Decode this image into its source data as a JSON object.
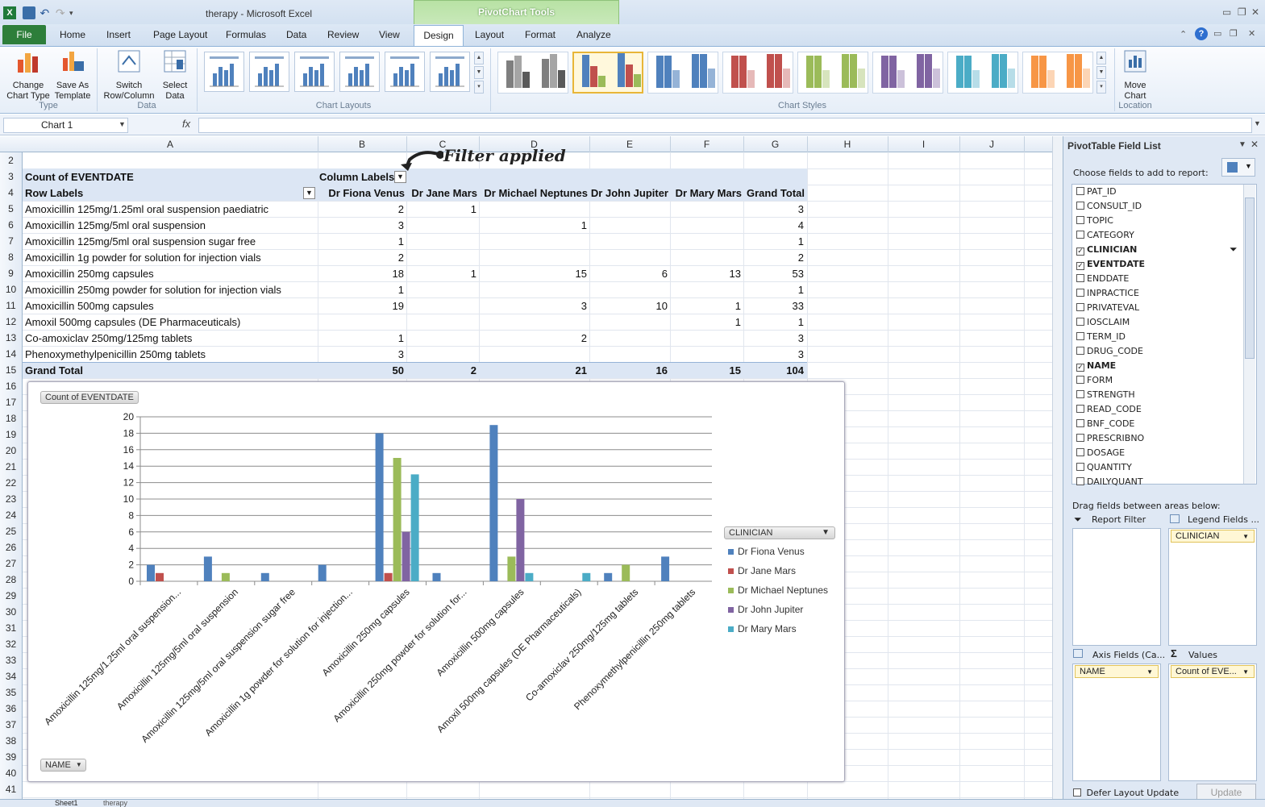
{
  "app": {
    "file_name": "therapy",
    "separator": " - ",
    "app_name": "Microsoft Excel",
    "context_group": "PivotChart Tools"
  },
  "tabs": {
    "file": "File",
    "home": "Home",
    "insert": "Insert",
    "page_layout": "Page Layout",
    "formulas": "Formulas",
    "data": "Data",
    "review": "Review",
    "view": "View",
    "design": "Design",
    "layout": "Layout",
    "format": "Format",
    "analyze": "Analyze"
  },
  "ribbon": {
    "change_chart_type": [
      "Change",
      "Chart Type"
    ],
    "save_as_template": [
      "Save As",
      "Template"
    ],
    "group_type": "Type",
    "switch_row_column": [
      "Switch",
      "Row/Column"
    ],
    "select_data": [
      "Select",
      "Data"
    ],
    "group_data": "Data",
    "group_layouts": "Chart Layouts",
    "group_styles": "Chart Styles",
    "move_chart": [
      "Move",
      "Chart"
    ],
    "group_location": "Location",
    "style_colors": [
      [
        "#7f7f7f",
        "#a5a5a5",
        "#595959"
      ],
      [
        "#4f81bd",
        "#c0504d",
        "#9bbb59"
      ],
      [
        "#4f81bd",
        "#4f81bd",
        "#95b3d7"
      ],
      [
        "#c0504d",
        "#c0504d",
        "#e6b9b8"
      ],
      [
        "#9bbb59",
        "#9bbb59",
        "#d7e4bd"
      ],
      [
        "#8064a2",
        "#8064a2",
        "#ccc1da"
      ],
      [
        "#4bacc6",
        "#4bacc6",
        "#b7dde8"
      ],
      [
        "#f79646",
        "#f79646",
        "#fcd5b5"
      ]
    ]
  },
  "formula_bar": {
    "name_box": "Chart 1",
    "fx": "fx",
    "formula": ""
  },
  "columns": [
    "A",
    "B",
    "C",
    "D",
    "E",
    "F",
    "G",
    "H",
    "I",
    "J"
  ],
  "rows": [
    "2",
    "3",
    "4",
    "5",
    "6",
    "7",
    "8",
    "9",
    "10",
    "11",
    "12",
    "13",
    "14",
    "15",
    "16",
    "17",
    "18",
    "19",
    "20",
    "21",
    "22",
    "23",
    "24",
    "25",
    "26",
    "27",
    "28",
    "29",
    "30",
    "31",
    "32",
    "33",
    "34",
    "35",
    "36",
    "37",
    "38",
    "39",
    "40",
    "41"
  ],
  "pivot": {
    "value_field": "Count of EVENTDATE",
    "column_labels": "Column Labels",
    "row_labels": "Row Labels",
    "clinicians": [
      "Dr Fiona Venus",
      "Dr Jane Mars",
      "Dr Michael Neptunes",
      "Dr John Jupiter",
      "Dr Mary Mars"
    ],
    "grand_total_label": "Grand Total",
    "rows": [
      {
        "name": "Amoxicillin 125mg/1.25ml oral suspension paediatric",
        "v": [
          "2",
          "1",
          "",
          "",
          "",
          "3"
        ]
      },
      {
        "name": "Amoxicillin 125mg/5ml oral suspension",
        "v": [
          "3",
          "",
          "1",
          "",
          "",
          "4"
        ]
      },
      {
        "name": "Amoxicillin 125mg/5ml oral suspension sugar free",
        "v": [
          "1",
          "",
          "",
          "",
          "",
          "1"
        ]
      },
      {
        "name": "Amoxicillin 1g powder for solution for injection vials",
        "v": [
          "2",
          "",
          "",
          "",
          "",
          "2"
        ]
      },
      {
        "name": "Amoxicillin 250mg capsules",
        "v": [
          "18",
          "1",
          "15",
          "6",
          "13",
          "53"
        ]
      },
      {
        "name": "Amoxicillin 250mg powder for solution for injection vials",
        "v": [
          "1",
          "",
          "",
          "",
          "",
          "1"
        ]
      },
      {
        "name": "Amoxicillin 500mg capsules",
        "v": [
          "19",
          "",
          "3",
          "10",
          "1",
          "33"
        ]
      },
      {
        "name": "Amoxil 500mg capsules (DE Pharmaceuticals)",
        "v": [
          "",
          "",
          "",
          "",
          "1",
          "1"
        ]
      },
      {
        "name": "Co-amoxiclav 250mg/125mg tablets",
        "v": [
          "1",
          "",
          "2",
          "",
          "",
          "3"
        ]
      },
      {
        "name": "Phenoxymethylpenicillin 250mg tablets",
        "v": [
          "3",
          "",
          "",
          "",
          "",
          "3"
        ]
      }
    ],
    "totals": [
      "50",
      "2",
      "21",
      "16",
      "15",
      "104"
    ]
  },
  "annotation": "Filter applied",
  "chart": {
    "value_button": "Count of EVENTDATE",
    "axis_button": "NAME",
    "legend_button": "CLINICIAN"
  },
  "chart_data": {
    "type": "bar",
    "categories": [
      "Amoxicillin 125mg/1.25ml oral suspension...",
      "Amoxicillin 125mg/5ml oral suspension",
      "Amoxicillin 125mg/5ml oral suspension sugar free",
      "Amoxicillin 1g powder for solution for injection...",
      "Amoxicillin 250mg capsules",
      "Amoxicillin 250mg powder for solution for...",
      "Amoxicillin 500mg capsules",
      "Amoxil 500mg capsules (DE Pharmaceuticals)",
      "Co-amoxiclav 250mg/125mg tablets",
      "Phenoxymethylpenicillin 250mg tablets"
    ],
    "series": [
      {
        "name": "Dr Fiona Venus",
        "color": "#4f81bd",
        "values": [
          2,
          3,
          1,
          2,
          18,
          1,
          19,
          0,
          1,
          3
        ]
      },
      {
        "name": "Dr Jane Mars",
        "color": "#c0504d",
        "values": [
          1,
          0,
          0,
          0,
          1,
          0,
          0,
          0,
          0,
          0
        ]
      },
      {
        "name": "Dr Michael Neptunes",
        "color": "#9bbb59",
        "values": [
          0,
          1,
          0,
          0,
          15,
          0,
          3,
          0,
          2,
          0
        ]
      },
      {
        "name": "Dr John Jupiter",
        "color": "#8064a2",
        "values": [
          0,
          0,
          0,
          0,
          6,
          0,
          10,
          0,
          0,
          0
        ]
      },
      {
        "name": "Dr Mary Mars",
        "color": "#4bacc6",
        "values": [
          0,
          0,
          0,
          0,
          13,
          0,
          1,
          1,
          0,
          0
        ]
      }
    ],
    "yticks": [
      "0",
      "2",
      "4",
      "6",
      "8",
      "10",
      "12",
      "14",
      "16",
      "18",
      "20"
    ],
    "ylim": [
      0,
      20
    ],
    "grid": true,
    "legend": "right"
  },
  "field_list": {
    "title": "PivotTable Field List",
    "choose": "Choose fields to add to report:",
    "fields": [
      {
        "name": "PAT_ID",
        "checked": false
      },
      {
        "name": "CONSULT_ID",
        "checked": false
      },
      {
        "name": "TOPIC",
        "checked": false
      },
      {
        "name": "CATEGORY",
        "checked": false
      },
      {
        "name": "CLINICIAN",
        "checked": true
      },
      {
        "name": "EVENTDATE",
        "checked": true
      },
      {
        "name": "ENDDATE",
        "checked": false
      },
      {
        "name": "INPRACTICE",
        "checked": false
      },
      {
        "name": "PRIVATEVAL",
        "checked": false
      },
      {
        "name": "IOSCLAIM",
        "checked": false
      },
      {
        "name": "TERM_ID",
        "checked": false
      },
      {
        "name": "DRUG_CODE",
        "checked": false
      },
      {
        "name": "NAME",
        "checked": true
      },
      {
        "name": "FORM",
        "checked": false
      },
      {
        "name": "STRENGTH",
        "checked": false
      },
      {
        "name": "READ_CODE",
        "checked": false
      },
      {
        "name": "BNF_CODE",
        "checked": false
      },
      {
        "name": "PRESCRIBNO",
        "checked": false
      },
      {
        "name": "DOSAGE",
        "checked": false
      },
      {
        "name": "QUANTITY",
        "checked": false
      },
      {
        "name": "DAILYQUANT",
        "checked": false
      }
    ],
    "drag_hint": "Drag fields between areas below:",
    "report_filter": "Report Filter",
    "legend_fields": "Legend Fields ...",
    "legend_value": "CLINICIAN",
    "axis_fields": "Axis Fields (Ca...",
    "axis_value": "NAME",
    "values": "Values",
    "values_value": "Count of EVE...",
    "defer": "Defer Layout Update",
    "update": "Update"
  },
  "sheet_tabs": [
    "Sheet1",
    "therapy"
  ]
}
